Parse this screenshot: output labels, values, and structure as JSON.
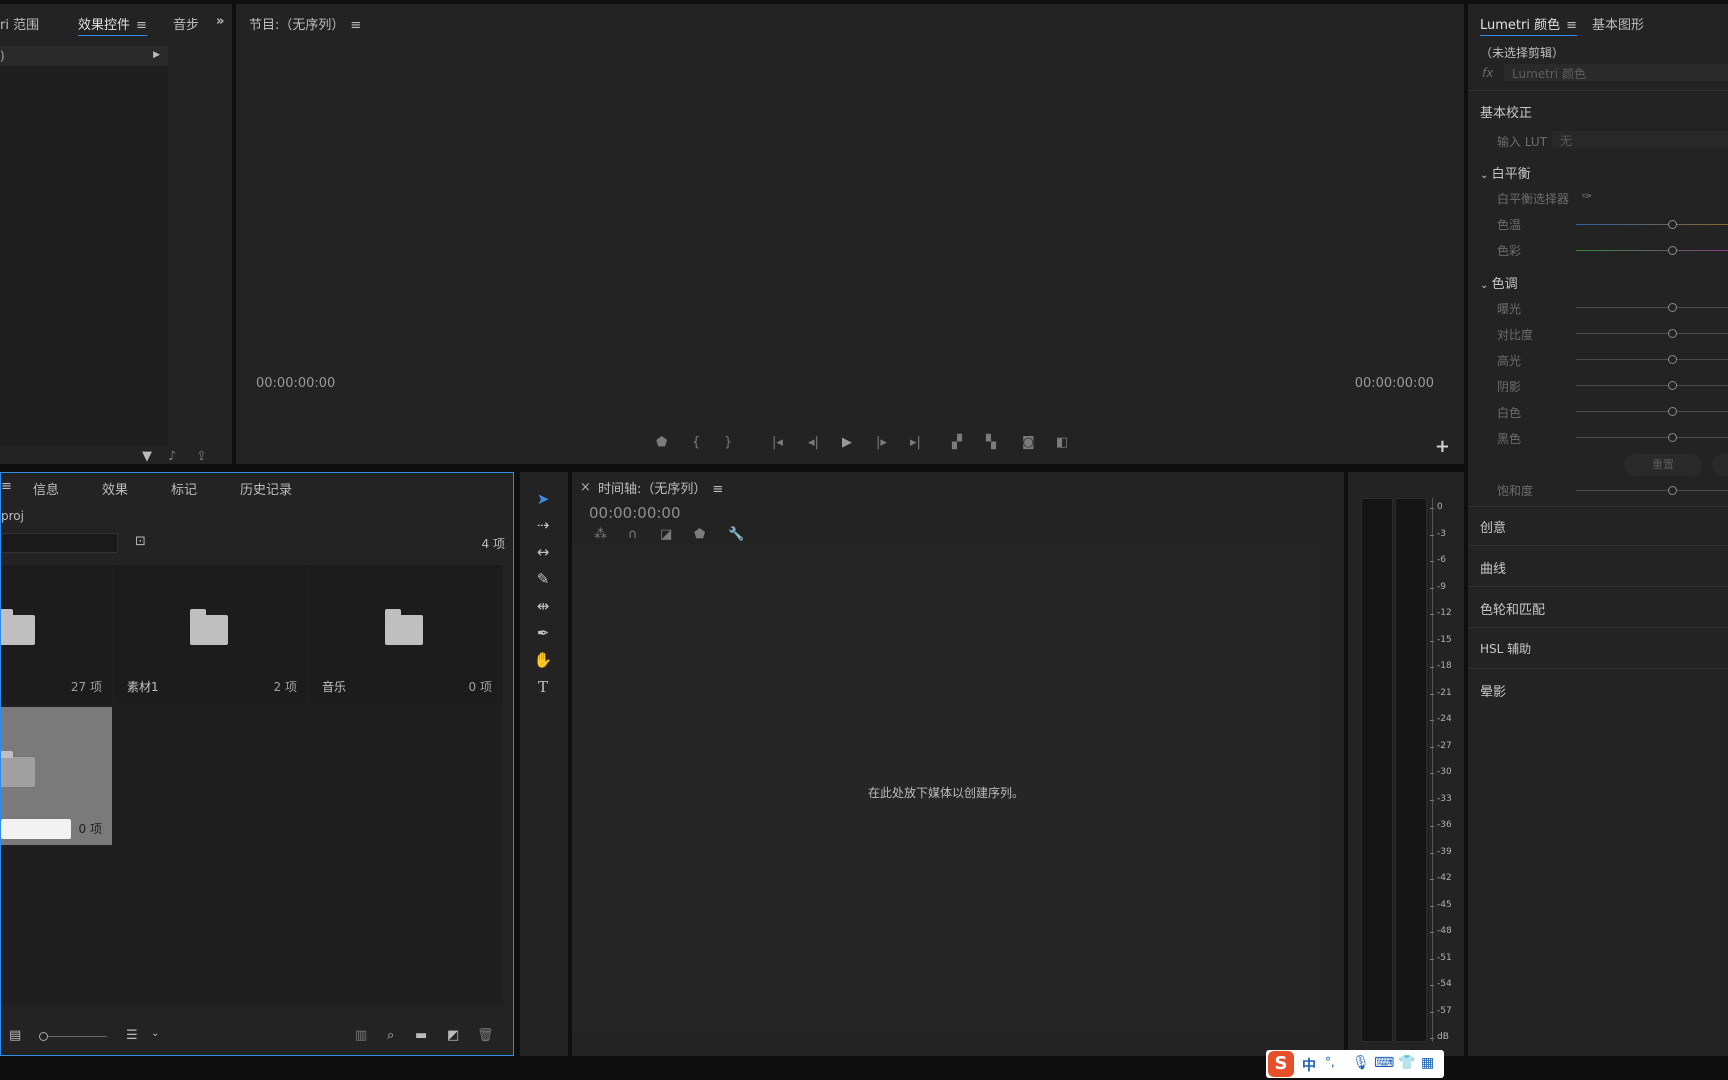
{
  "effects_panel": {
    "tabs": [
      "ri 范围",
      "效果控件",
      "音步"
    ],
    "more": "»",
    "clip_header": ")"
  },
  "program_monitor": {
    "title": "节目:（无序列）",
    "timecode_left": "00:00:00:00",
    "timecode_right": "00:00:00:00",
    "add_button": "+"
  },
  "project_panel": {
    "tabs": [
      "信息",
      "效果",
      "标记",
      "历史记录"
    ],
    "project_file": "proj",
    "item_count": "4 项",
    "bins": [
      {
        "name": "",
        "count": "27 项"
      },
      {
        "name": "素材1",
        "count": "2 项"
      },
      {
        "name": "音乐",
        "count": "0 项"
      },
      {
        "name": "",
        "count": "0 项"
      }
    ]
  },
  "timeline": {
    "close": "×",
    "title": "时间轴:（无序列）",
    "timecode": "00:00:00:00",
    "drop_hint": "在此处放下媒体以创建序列。"
  },
  "audio_meter": {
    "labels": [
      "0",
      "-3",
      "-6",
      "-9",
      "-12",
      "-15",
      "-18",
      "-21",
      "-24",
      "-27",
      "-30",
      "-33",
      "-36",
      "-39",
      "-42",
      "-45",
      "-48",
      "-51",
      "-54",
      "-57",
      "dB"
    ]
  },
  "lumetri": {
    "tabs": [
      "Lumetri 颜色",
      "基本图形"
    ],
    "no_clip": "（未选择剪辑）",
    "fx_label": "fx",
    "fx_value": "Lumetri 颜色",
    "basic_correction": "基本校正",
    "input_lut_label": "输入 LUT",
    "input_lut_value": "无",
    "white_balance": "白平衡",
    "wb_selector": "白平衡选择器",
    "temperature": "色温",
    "tint": "色彩",
    "tone": "色调",
    "exposure": "曝光",
    "contrast": "对比度",
    "highlights": "高光",
    "shadows": "阴影",
    "whites": "白色",
    "blacks": "黑色",
    "reset": "重置",
    "saturation": "饱和度",
    "creative": "创意",
    "curves": "曲线",
    "color_wheels": "色轮和匹配",
    "hsl": "HSL 辅助",
    "vignette": "晕影"
  },
  "ime": {
    "lang": "中",
    "punct": "°,"
  },
  "colors": {
    "accent": "#2d8ceb",
    "panel": "#232323",
    "background": "#0f0f0f"
  }
}
